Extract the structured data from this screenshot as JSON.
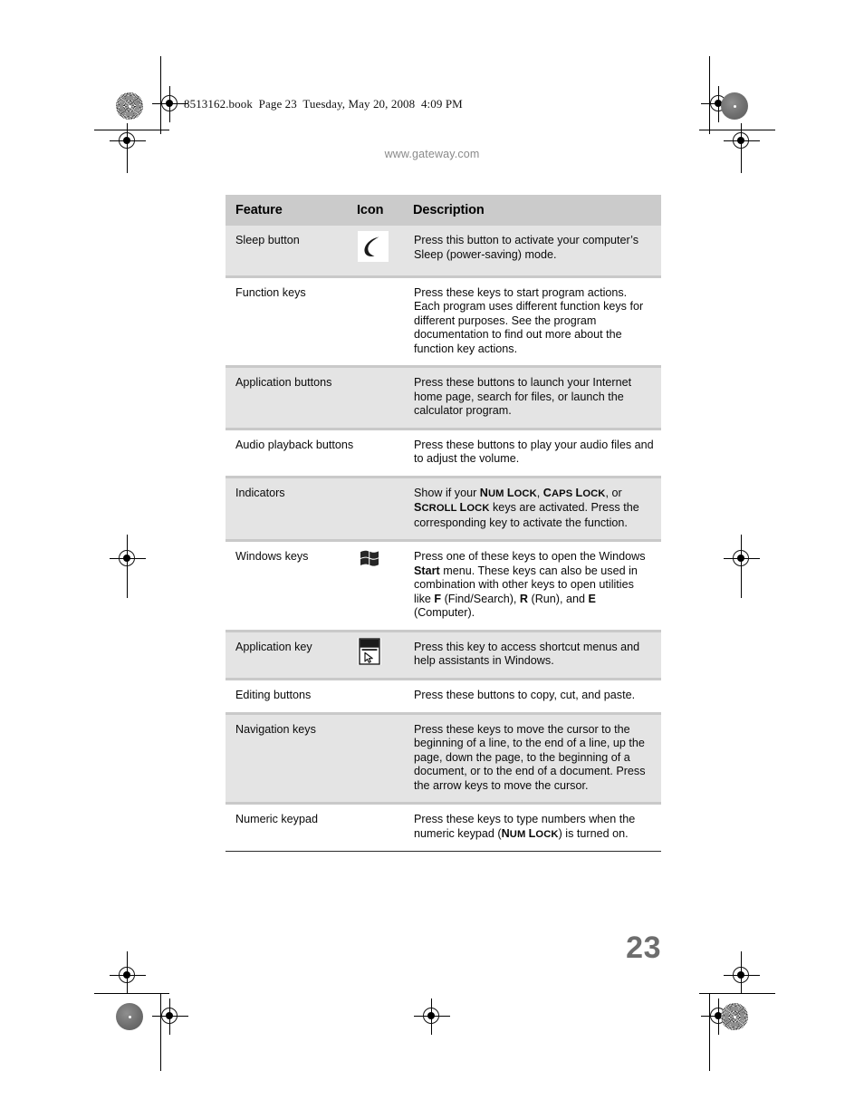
{
  "page": {
    "book_line": "8513162.book  Page 23  Tuesday, May 20, 2008  4:09 PM",
    "site_url": "www.gateway.com",
    "page_number": "23"
  },
  "table": {
    "headers": {
      "feature": "Feature",
      "icon": "Icon",
      "description": "Description"
    },
    "rows": [
      {
        "feature": "Sleep button",
        "icon": "crescent-moon-icon",
        "description_plain": "Press this button to activate your computer’s Sleep (power-saving) mode."
      },
      {
        "feature": "Function keys",
        "icon": "",
        "description_plain": "Press these keys to start program actions. Each program uses different function keys for different purposes. See the program documentation to find out more about the function key actions."
      },
      {
        "feature": "Application buttons",
        "icon": "",
        "description_plain": "Press these buttons to launch your Internet home page, search for files, or launch the calculator program."
      },
      {
        "feature": "Audio playback buttons",
        "icon": "",
        "description_plain": "Press these buttons to play your audio files and to adjust the volume."
      },
      {
        "feature": "Indicators",
        "icon": "",
        "description_plain": "Show if your NUM LOCK, CAPS LOCK, or SCROLL LOCK keys are activated. Press the corresponding key to activate the function."
      },
      {
        "feature": "Windows keys",
        "icon": "windows-flag-icon",
        "description_plain": "Press one of these keys to open the Windows Start menu. These keys can also be used in combination with other keys to open utilities like F (Find/Search), R (Run), and E (Computer)."
      },
      {
        "feature": "Application key",
        "icon": "application-key-icon",
        "description_plain": "Press this key to access shortcut menus and help assistants in Windows."
      },
      {
        "feature": "Editing buttons",
        "icon": "",
        "description_plain": "Press these buttons to copy, cut, and paste."
      },
      {
        "feature": "Navigation keys",
        "icon": "",
        "description_plain": "Press these keys to move the cursor to the beginning of a line, to the end of a line, up the page, down the page, to the beginning of a document, or to the end of a document. Press the arrow keys to move the cursor."
      },
      {
        "feature": "Numeric keypad",
        "icon": "",
        "description_plain": "Press these keys to type numbers when the numeric keypad (NUM LOCK) is turned on."
      }
    ],
    "description_fragments": {
      "sleep": "Press this button to activate your computer’s Sleep (power-saving) mode.",
      "function_keys": "Press these keys to start program actions. Each program uses different function keys for different purposes. See the program documentation to find out more about the function key actions.",
      "application_buttons": "Press these buttons to launch your Internet home page, search for files, or launch the calculator program.",
      "audio": "Press these buttons to play your audio files and to adjust the volume.",
      "indicators_a": "Show if your ",
      "indicators_numlock_n": "N",
      "indicators_numlock_um": "UM",
      "indicators_numlock_l": "L",
      "indicators_numlock_ock": "OCK",
      "indicators_b": ", ",
      "indicators_capslock_c": "C",
      "indicators_capslock_aps": "APS",
      "indicators_capslock_l": "L",
      "indicators_capslock_ock": "OCK",
      "indicators_c": ", or ",
      "indicators_scrolllock_s": "S",
      "indicators_scrolllock_croll": "CROLL",
      "indicators_scrolllock_l": "L",
      "indicators_scrolllock_ock": "OCK",
      "indicators_d": " keys are activated. Press the corresponding key to activate the function.",
      "windows_a": "Press one of these keys to open the Windows ",
      "windows_start": "Start",
      "windows_b": " menu. These keys can also be used in combination with other keys to open utilities like ",
      "windows_f": "F",
      "windows_c": " (Find/Search), ",
      "windows_r": "R",
      "windows_d": " (Run), and ",
      "windows_e": "E",
      "windows_f2": " (Computer).",
      "application_key": "Press this key to access shortcut menus and help assistants in Windows.",
      "editing": "Press these buttons to copy, cut, and paste.",
      "navigation": "Press these keys to move the cursor to the beginning of a line, to the end of a line, up the page, down the page, to the beginning of a document, or to the end of a document. Press the arrow keys to move the cursor.",
      "numeric_a": "Press these keys to type numbers when the numeric keypad (",
      "numeric_numlock_n": "N",
      "numeric_numlock_um": "UM",
      "numeric_numlock_l": "L",
      "numeric_numlock_ock": "OCK",
      "numeric_b": ") is turned on."
    }
  },
  "colors": {
    "header_bg": "#cbcbcb",
    "row_shade": "#e4e4e4",
    "row_plain": "#ffffff",
    "divider": "#c9c9c9",
    "page_number": "#6d6d6d",
    "url_text": "#8a8a8a"
  }
}
